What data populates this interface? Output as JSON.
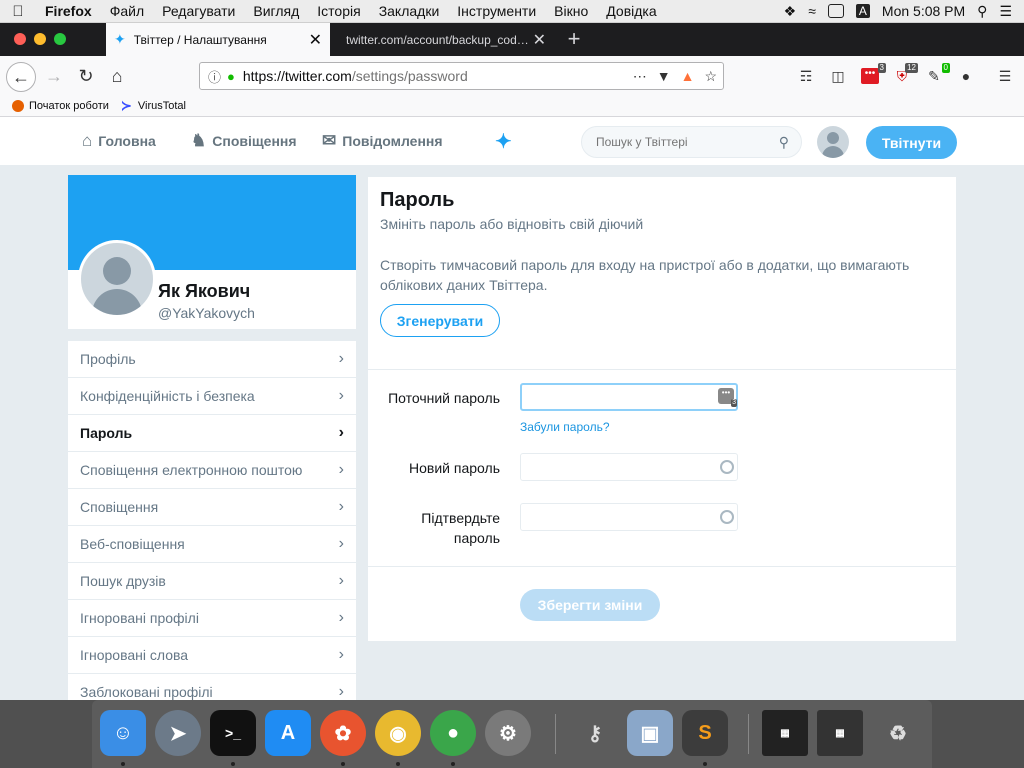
{
  "macos_menu": {
    "app": "Firefox",
    "items": [
      "Файл",
      "Редагувати",
      "Вигляд",
      "Історія",
      "Закладки",
      "Інструменти",
      "Вікно",
      "Довідка"
    ],
    "input_source": "A",
    "clock": "Mon 5:08 PM"
  },
  "browser": {
    "tabs": [
      {
        "title": "Твіттер / Налаштування",
        "active": true
      },
      {
        "title": "twitter.com/account/backup_code/p",
        "active": false
      }
    ],
    "url_host": "https://twitter.com",
    "url_path": "/settings/password",
    "extension_badges": {
      "ext1": "3",
      "ext2": "12",
      "ext3": "0"
    },
    "bookmarks": [
      "Початок роботи",
      "VirusTotal"
    ]
  },
  "twitter_header": {
    "nav": [
      "Головна",
      "Сповіщення",
      "Повідомлення"
    ],
    "search_placeholder": "Пошук у Твіттері",
    "tweet_button": "Твітнути"
  },
  "profile": {
    "name": "Як Якович",
    "handle": "@YakYakovych"
  },
  "settings_menu": [
    {
      "label": "Профіль",
      "active": false
    },
    {
      "label": "Конфіденційність і безпека",
      "active": false
    },
    {
      "label": "Пароль",
      "active": true
    },
    {
      "label": "Сповіщення електронною поштою",
      "active": false
    },
    {
      "label": "Сповіщення",
      "active": false
    },
    {
      "label": "Веб-сповіщення",
      "active": false
    },
    {
      "label": "Пошук друзів",
      "active": false
    },
    {
      "label": "Ігноровані профілі",
      "active": false
    },
    {
      "label": "Ігноровані слова",
      "active": false
    },
    {
      "label": "Заблоковані профілі",
      "active": false
    }
  ],
  "password_page": {
    "title": "Пароль",
    "subtitle": "Змініть пароль або відновіть свій діючий",
    "temp_desc": "Створіть тимчасовий пароль для входу на пристрої або в додатки, що вимагають облікових даних Твіттера.",
    "generate_button": "Згенерувати",
    "current_label": "Поточний пароль",
    "current_value": "",
    "forgot_link": "Забули пароль?",
    "new_label": "Новий пароль",
    "new_value": "",
    "confirm_label_1": "Підтвердьте",
    "confirm_label_2": "пароль",
    "confirm_value": "",
    "pw_manager_badge": "3",
    "save_button": "Зберегти зміни"
  },
  "colors": {
    "twitter_blue": "#1da1f2",
    "tweet_button": "#4ab3f4",
    "save_disabled": "#bbddf5",
    "page_bg": "#e6ecf0"
  }
}
